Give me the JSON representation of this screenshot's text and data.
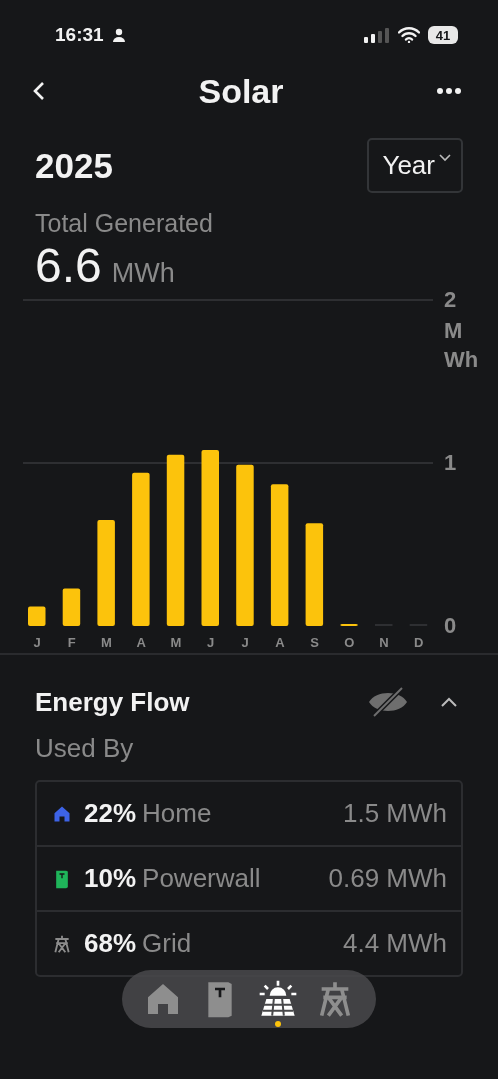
{
  "status_bar": {
    "time": "16:31",
    "battery": "41"
  },
  "header": {
    "title": "Solar"
  },
  "period": {
    "year": "2025",
    "range": "Year"
  },
  "total": {
    "label": "Total Generated",
    "value": "6.6",
    "unit": "MWh"
  },
  "chart_data": {
    "type": "bar",
    "categories": [
      "J",
      "F",
      "M",
      "A",
      "M",
      "J",
      "J",
      "A",
      "S",
      "O",
      "N",
      "D"
    ],
    "ylabel": "MWh",
    "ylim": [
      0,
      2
    ],
    "yticks": [
      0,
      1,
      2
    ],
    "series": [
      {
        "color": "#fcc30c",
        "values": [
          0.12,
          0.23,
          0.65,
          0.94,
          1.05,
          1.08,
          0.99,
          0.87,
          0.63,
          0.01,
          0,
          0
        ]
      }
    ]
  },
  "energy_flow": {
    "title": "Energy Flow",
    "subtitle": "Used By",
    "expanded": true,
    "rows": [
      {
        "kind": "home",
        "color": "#3d63e6",
        "percent": "22%",
        "name": "Home",
        "amount": "1.5 MWh"
      },
      {
        "kind": "powerwall",
        "color": "#1fb55a",
        "percent": "10%",
        "name": "Powerwall",
        "amount": "0.69 MWh"
      },
      {
        "kind": "grid",
        "color": "#8c8c8c",
        "percent": "68%",
        "name": "Grid",
        "amount": "4.4 MWh"
      }
    ]
  },
  "tab_bar": [
    {
      "kind": "home",
      "selected": false
    },
    {
      "kind": "powerwall",
      "selected": false
    },
    {
      "kind": "solar",
      "selected": true
    },
    {
      "kind": "grid",
      "selected": false
    }
  ]
}
